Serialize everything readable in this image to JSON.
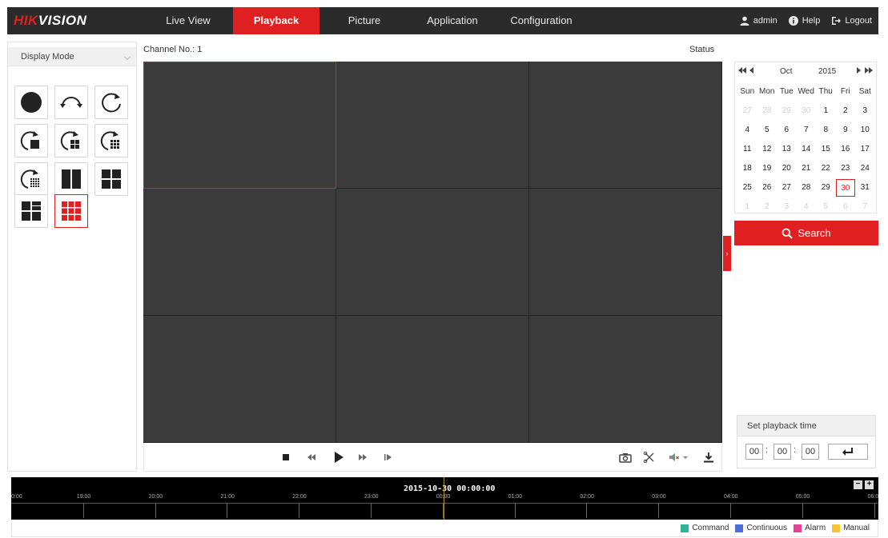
{
  "app": {
    "logo_red": "HIK",
    "logo_white": "VISION"
  },
  "nav": [
    {
      "label": "Live View",
      "active": false
    },
    {
      "label": "Playback",
      "active": true
    },
    {
      "label": "Picture",
      "active": false
    },
    {
      "label": "Application",
      "active": false
    },
    {
      "label": "Configuration",
      "active": false
    }
  ],
  "user": {
    "username": "admin",
    "help": "Help",
    "logout": "Logout"
  },
  "left_panel": {
    "display_mode_label": "Display Mode",
    "modes": [
      "single-circle-icon",
      "arc-arrow-icon",
      "refresh-icon",
      "refresh-1x1-icon",
      "refresh-2x2-icon",
      "refresh-3x3-icon",
      "refresh-4x4-icon",
      "two-column-icon",
      "four-grid-icon",
      "mixed-grid-icon",
      "nine-grid-icon"
    ],
    "active_mode": "nine-grid-icon"
  },
  "video": {
    "channel_label": "Channel No.: 1",
    "status_label": "Status",
    "selected_cell": 0
  },
  "calendar": {
    "month": "Oct",
    "year": "2015",
    "weekdays": [
      "Sun",
      "Mon",
      "Tue",
      "Wed",
      "Thu",
      "Fri",
      "Sat"
    ],
    "days": [
      [
        "27",
        "m"
      ],
      [
        "28",
        "m"
      ],
      [
        "29",
        "m"
      ],
      [
        "30",
        "m"
      ],
      [
        "1",
        "c"
      ],
      [
        "2",
        "c"
      ],
      [
        "3",
        "c"
      ],
      [
        "4",
        "c"
      ],
      [
        "5",
        "c"
      ],
      [
        "6",
        "c"
      ],
      [
        "7",
        "c"
      ],
      [
        "8",
        "c"
      ],
      [
        "9",
        "c"
      ],
      [
        "10",
        "c"
      ],
      [
        "11",
        "c"
      ],
      [
        "12",
        "c"
      ],
      [
        "13",
        "c"
      ],
      [
        "14",
        "c"
      ],
      [
        "15",
        "c"
      ],
      [
        "16",
        "c"
      ],
      [
        "17",
        "c"
      ],
      [
        "18",
        "c"
      ],
      [
        "19",
        "c"
      ],
      [
        "20",
        "c"
      ],
      [
        "21",
        "c"
      ],
      [
        "22",
        "c"
      ],
      [
        "23",
        "c"
      ],
      [
        "24",
        "c"
      ],
      [
        "25",
        "c"
      ],
      [
        "26",
        "c"
      ],
      [
        "27",
        "c"
      ],
      [
        "28",
        "c"
      ],
      [
        "29",
        "c"
      ],
      [
        "30",
        "t"
      ],
      [
        "31",
        "c"
      ],
      [
        "1",
        "m"
      ],
      [
        "2",
        "m"
      ],
      [
        "3",
        "m"
      ],
      [
        "4",
        "m"
      ],
      [
        "5",
        "m"
      ],
      [
        "6",
        "m"
      ],
      [
        "7",
        "m"
      ]
    ]
  },
  "search": {
    "label": "Search"
  },
  "playback_time": {
    "header": "Set playback time",
    "hour": "00",
    "minute": "00",
    "second": "00"
  },
  "timeline": {
    "current": "2015-10-30 00:00:00",
    "labels": [
      "0:00",
      "19:00",
      "20:00",
      "21:00",
      "22:00",
      "23:00",
      "00:00",
      "01:00",
      "02:00",
      "03:00",
      "04:00",
      "05:00",
      "06:0"
    ],
    "zoom_out": "−",
    "zoom_in": "+"
  },
  "legend": [
    {
      "label": "Command",
      "color": "#2fb39a"
    },
    {
      "label": "Continuous",
      "color": "#4f6fd8"
    },
    {
      "label": "Alarm",
      "color": "#e8409a"
    },
    {
      "label": "Manual",
      "color": "#f2c531"
    }
  ],
  "colors": {
    "accent": "#e02020",
    "topbar": "#2b2b2b",
    "video_bg": "#3b3b3b"
  }
}
